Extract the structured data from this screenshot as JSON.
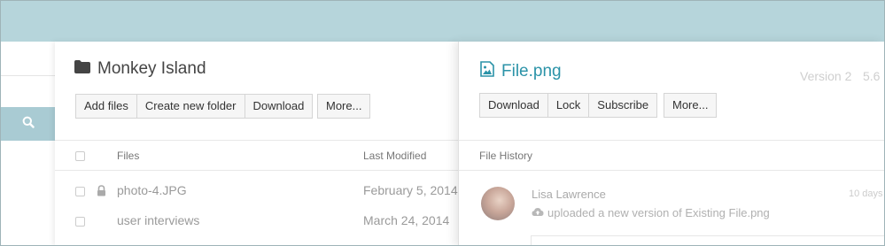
{
  "main": {
    "folder_name": "Monkey Island",
    "toolbar": {
      "add_files": "Add files",
      "create_folder": "Create new folder",
      "download": "Download",
      "more": "More..."
    },
    "columns": {
      "files": "Files",
      "last_modified": "Last Modified"
    },
    "rows": [
      {
        "name": "photo-4.JPG",
        "modified": "February 5, 2014",
        "locked": true
      },
      {
        "name": "user interviews",
        "modified": "March 24, 2014",
        "locked": false
      }
    ]
  },
  "detail": {
    "file_name": "File.png",
    "version": "Version 2",
    "version_size": "5.6",
    "toolbar": {
      "download": "Download",
      "lock": "Lock",
      "subscribe": "Subscribe",
      "more": "More..."
    },
    "section_title": "File History",
    "history": [
      {
        "user": "Lisa Lawrence",
        "action": "uploaded a new version of Existing File.png",
        "time": "10 days"
      }
    ]
  },
  "icons": {
    "search": "search-icon",
    "folder": "folder-icon",
    "image_file": "image-file-icon",
    "lock": "lock-icon",
    "cloud_upload": "cloud-upload-icon"
  },
  "colors": {
    "background": "#b6d5db",
    "search_bar": "#a9cbd3",
    "accent": "#2b93a8"
  }
}
